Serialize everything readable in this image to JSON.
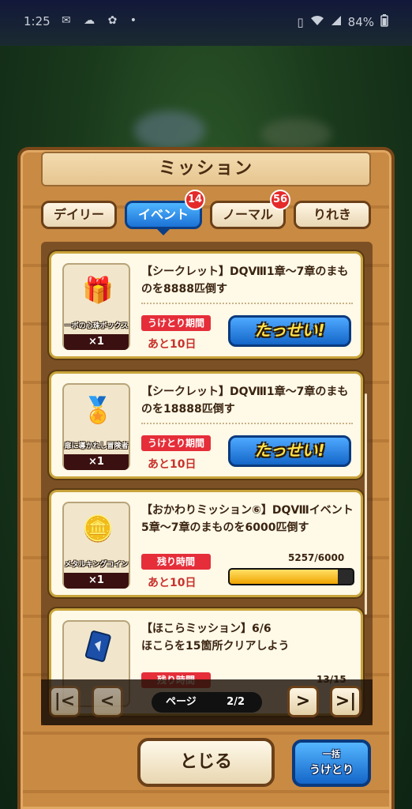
{
  "status_bar": {
    "time": "1:25",
    "notification_icons": "✉ ☁ ✿ •",
    "battery": "84%"
  },
  "dialog": {
    "title": "ミッション"
  },
  "tabs": [
    {
      "label": "デイリー",
      "active": false,
      "badge": ""
    },
    {
      "label": "イベント",
      "active": true,
      "badge": "14"
    },
    {
      "label": "ノーマル",
      "active": false,
      "badge": "56"
    },
    {
      "label": "りれき",
      "active": false,
      "badge": ""
    }
  ],
  "missions": [
    {
      "text": "【シークレット】DQⅧ1章～7章のまものを8888匹倒す",
      "reward_name": "ーボの心珠ボックス",
      "reward_icon": "gift-box-icon",
      "reward_qty": "×1",
      "period_label": "うけとり期間",
      "remaining": "あと10日",
      "action": "たっせい!"
    },
    {
      "text": "【シークレット】DQⅧ1章～7章のまものを18888匹倒す",
      "reward_name": "扉に導かれし冒険者",
      "reward_icon": "medal-icon",
      "reward_qty": "×1",
      "period_label": "うけとり期間",
      "remaining": "あと10日",
      "action": "たっせい!"
    },
    {
      "text": "【おかわりミッション⑥】DQⅧイベント5章～7章のまものを6000匹倒す",
      "reward_name": "メタルキングコイン",
      "reward_icon": "coin-icon",
      "reward_qty": "×1",
      "period_label": "残り時間",
      "remaining": "あと10日",
      "progress_text": "5257/6000",
      "progress": 0.876
    },
    {
      "text": "【ほこらミッション】6/6\nほこらを15箇所クリアしよう",
      "reward_name": "",
      "reward_icon": "card-icon",
      "reward_qty": "",
      "period_label": "残り時間",
      "remaining": "",
      "progress_text": "13/15",
      "progress": 0.867
    }
  ],
  "pager": {
    "first_label": "|<",
    "prev_label": "<",
    "next_label": ">",
    "last_label": ">|",
    "page_label": "ページ",
    "page_value": "2/2"
  },
  "buttons": {
    "close": "とじる",
    "collect_line1": "一括",
    "collect_line2": "うけとり"
  }
}
